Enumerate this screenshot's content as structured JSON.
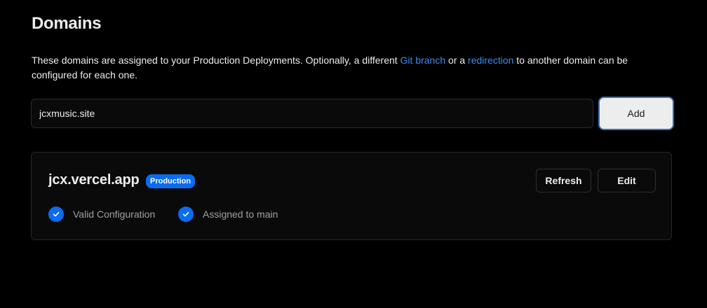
{
  "section": {
    "title": "Domains",
    "description_pre": "These domains are assigned to your Production Deployments. Optionally, a different ",
    "link_git_branch": "Git branch",
    "description_mid": " or a ",
    "link_redirection": "redirection",
    "description_post": " to another domain can be configured for each one."
  },
  "add_domain": {
    "input_value": "jcxmusic.site",
    "button_label": "Add"
  },
  "domain_card": {
    "domain": "jcx.vercel.app",
    "badge": "Production",
    "refresh_label": "Refresh",
    "edit_label": "Edit",
    "statuses": [
      {
        "label": "Valid Configuration",
        "icon": "check-icon"
      },
      {
        "label": "Assigned to main",
        "icon": "check-icon"
      }
    ]
  },
  "colors": {
    "background": "#000000",
    "accent": "#0a6cf0",
    "link": "#3b8cf0",
    "text": "#ededed",
    "muted": "#a1a1a1"
  }
}
